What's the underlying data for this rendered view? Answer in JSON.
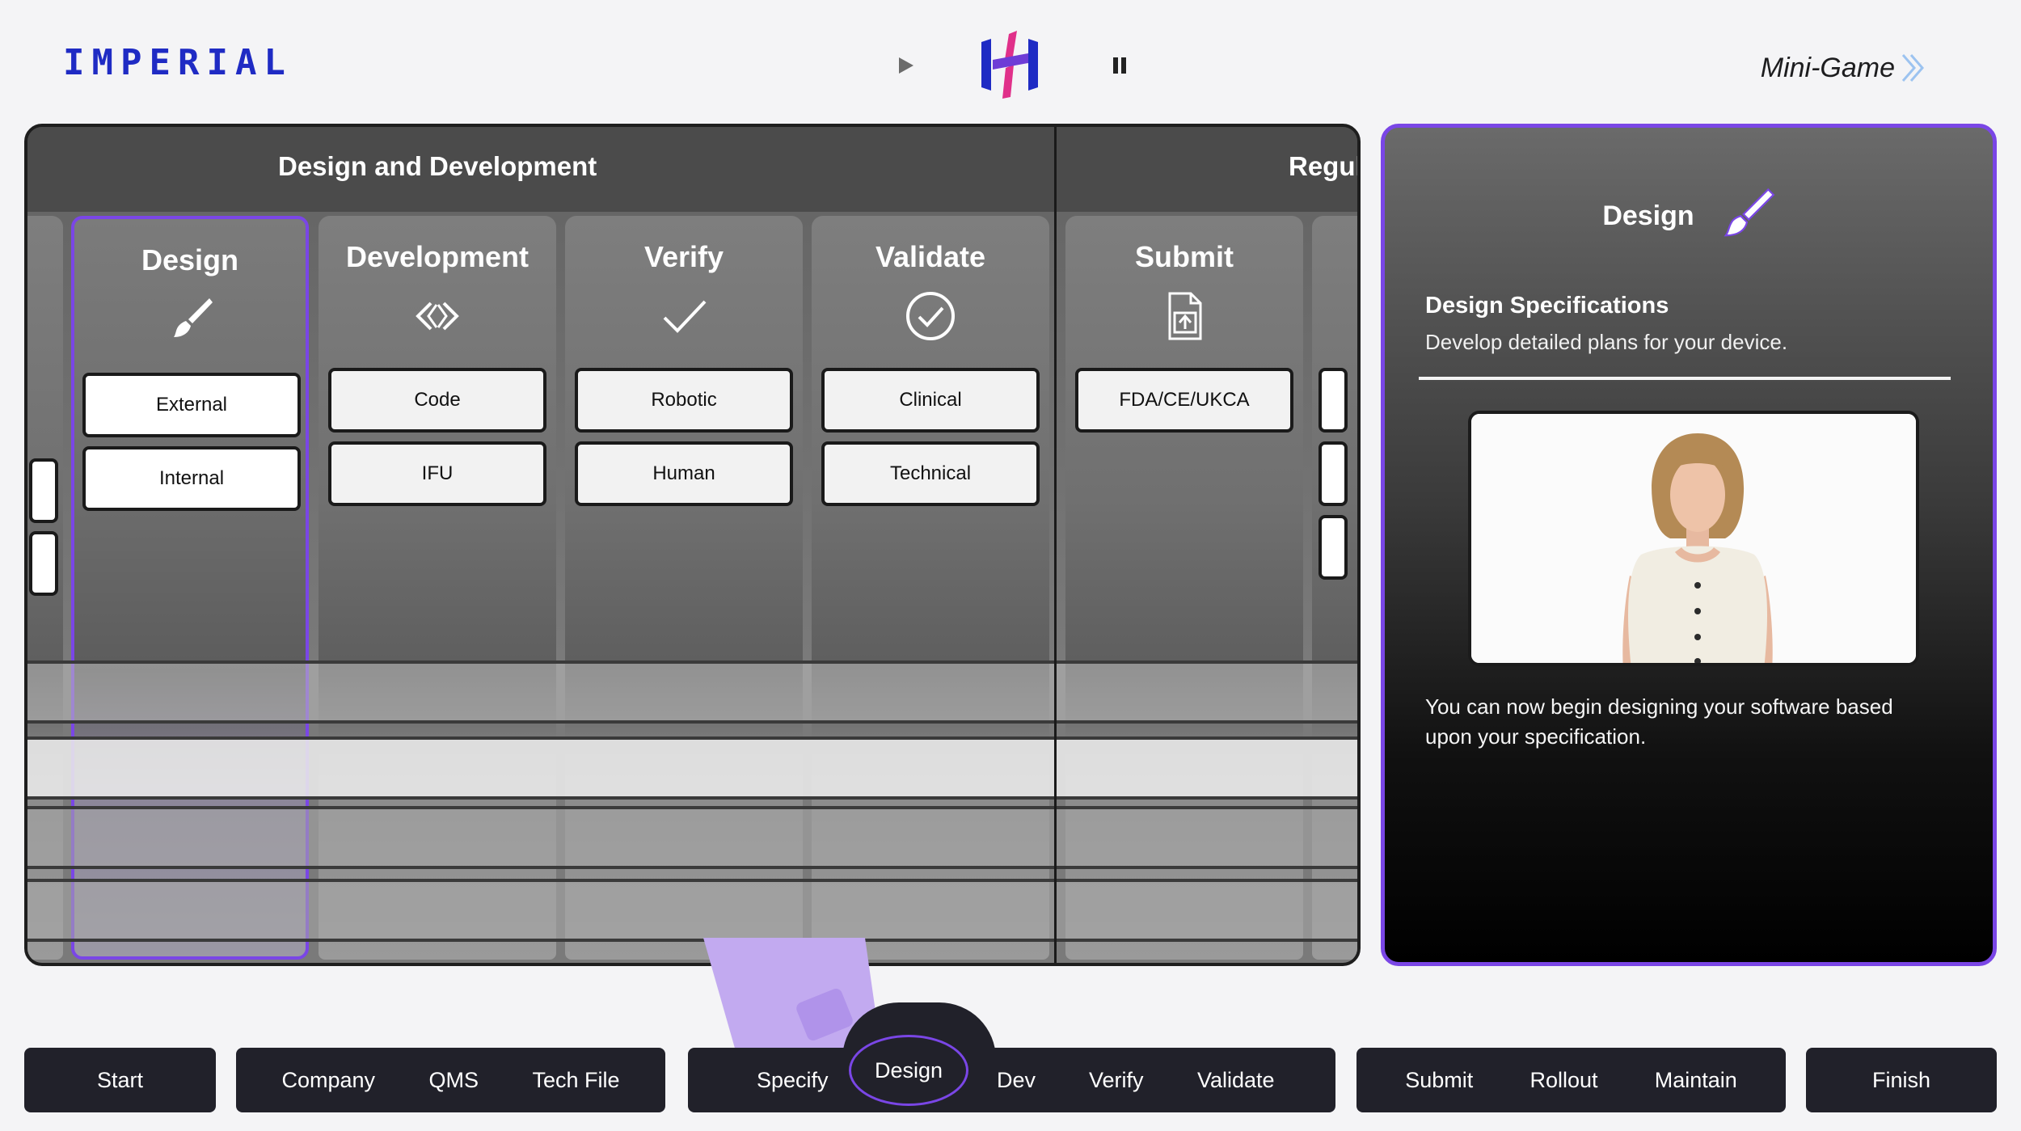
{
  "header": {
    "logo": "IMPERIAL",
    "minigame_label": "Mini-Game"
  },
  "board": {
    "sections": [
      "Design and Development",
      "Regul"
    ],
    "columns": [
      {
        "title": "Design",
        "icon": "paintbrush-icon",
        "chips": [
          "External",
          "Internal"
        ],
        "active": true
      },
      {
        "title": "Development",
        "icon": "code-brackets-icon",
        "chips": [
          "Code",
          "IFU"
        ]
      },
      {
        "title": "Verify",
        "icon": "checkmark-icon",
        "chips": [
          "Robotic",
          "Human"
        ]
      },
      {
        "title": "Validate",
        "icon": "check-circle-icon",
        "chips": [
          "Clinical",
          "Technical"
        ]
      },
      {
        "title": "Submit",
        "icon": "document-upload-icon",
        "chips": [
          "FDA/CE/UKCA"
        ]
      }
    ]
  },
  "panel": {
    "title": "Design",
    "icon": "paintbrush-icon",
    "subtitle": "Design Specifications",
    "description": "Develop detailed plans for your device.",
    "body": "You can now begin designing your software based upon your specification."
  },
  "progress": {
    "groups": [
      [
        "Start"
      ],
      [
        "Company",
        "QMS",
        "Tech File"
      ],
      [
        "Specify",
        "Design",
        "Dev",
        "Verify",
        "Validate"
      ],
      [
        "Submit",
        "Rollout",
        "Maintain"
      ],
      [
        "Finish"
      ]
    ],
    "current": "Design"
  },
  "colors": {
    "accent": "#7a46e6",
    "logo": "#1f2bc4",
    "nav_bg": "#21212a"
  }
}
